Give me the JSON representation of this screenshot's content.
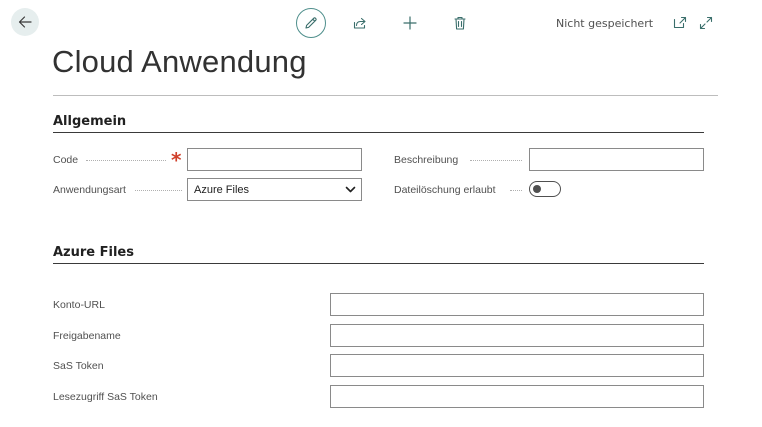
{
  "header": {
    "status": "Nicht gespeichert",
    "icons": {
      "back": "arrow-left-icon",
      "edit": "pencil-icon",
      "share": "share-icon",
      "new": "plus-icon",
      "delete": "trash-icon",
      "open_new_window": "open-in-new-window-icon",
      "expand": "expand-icon"
    }
  },
  "page": {
    "title": "Cloud Anwendung"
  },
  "sections": {
    "general": {
      "title": "Allgemein",
      "fields": {
        "code": {
          "label": "Code",
          "value": "",
          "required": "*"
        },
        "description": {
          "label": "Beschreibung",
          "value": ""
        },
        "app_type": {
          "label": "Anwendungsart",
          "value": "Azure Files"
        },
        "file_deletion": {
          "label": "Dateilöschung erlaubt",
          "value": false
        }
      }
    },
    "azure": {
      "title": "Azure Files",
      "fields": {
        "account_url": {
          "label": "Konto-URL",
          "value": ""
        },
        "share_name": {
          "label": "Freigabename",
          "value": ""
        },
        "sas_token": {
          "label": "SaS Token",
          "value": ""
        },
        "read_sas_token": {
          "label": "Lesezugriff SaS Token",
          "value": ""
        }
      }
    }
  },
  "colors": {
    "accent": "#4f8f8c",
    "required": "#d0402b",
    "back_button_bg": "#e6eeee"
  }
}
